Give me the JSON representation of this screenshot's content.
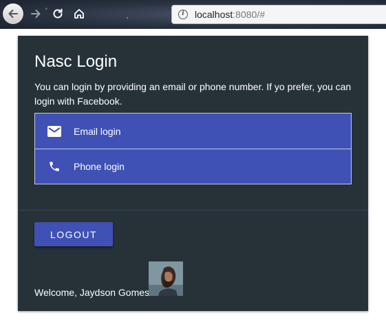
{
  "browser": {
    "url_host": "localhost",
    "url_rest": ":8080/#"
  },
  "icons": {
    "back": "back-arrow-icon",
    "forward": "forward-arrow-icon",
    "reload": "reload-icon",
    "home": "home-icon",
    "site_info": "info-icon",
    "email": "email-icon",
    "phone": "phone-icon"
  },
  "card": {
    "title": "Nasc Login",
    "description": "You can login by providing an email or phone number. If yo prefer, you can login with Facebook.",
    "login_options": [
      {
        "label": "Email login",
        "icon": "email-icon"
      },
      {
        "label": "Phone login",
        "icon": "phone-icon"
      }
    ],
    "logout_label": "LOGOUT",
    "welcome_text": "Welcome, Jaydson Gomes"
  },
  "colors": {
    "card_background": "#263238",
    "primary": "#3f51b5",
    "list_border": "#c5cae9"
  }
}
